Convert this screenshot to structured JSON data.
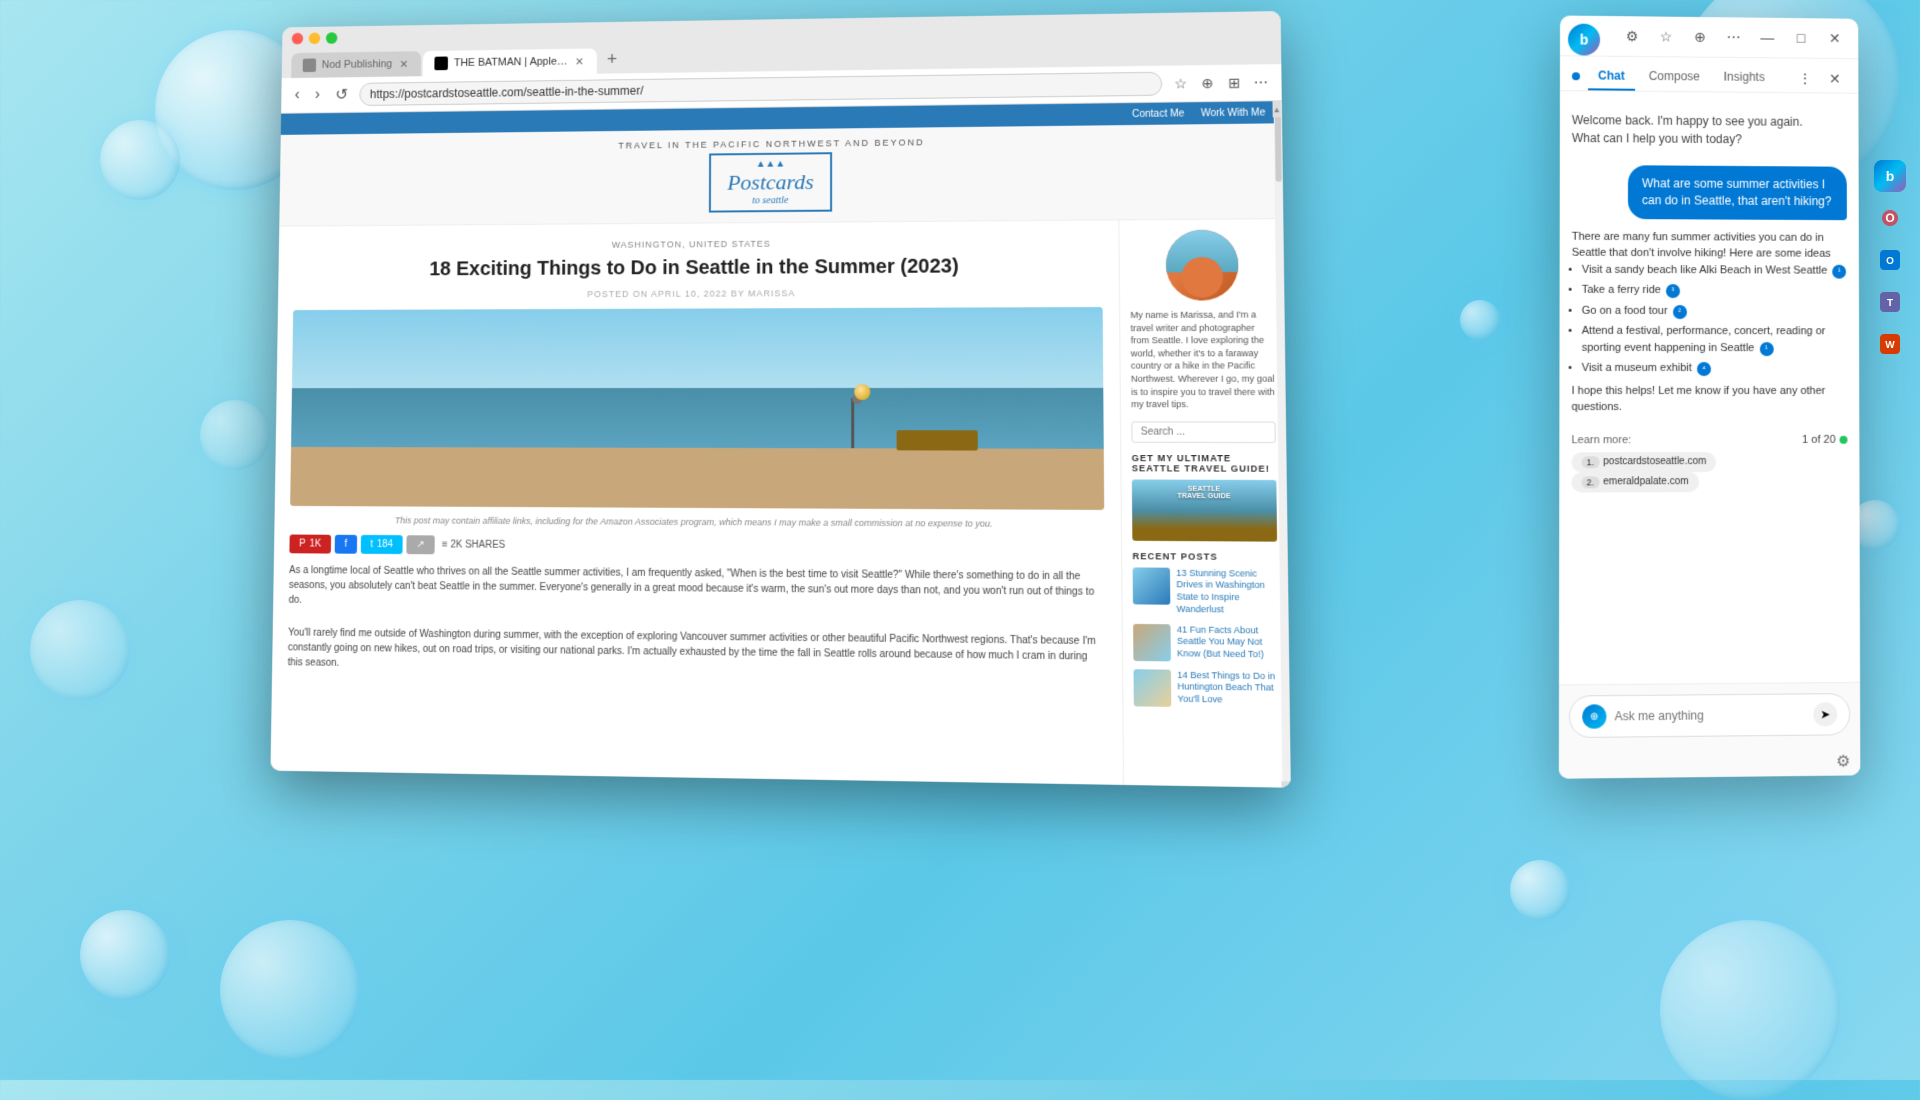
{
  "background": {
    "color": "#7dd4ea"
  },
  "browser": {
    "tabs": [
      {
        "id": "tab1",
        "label": "Nod Publishing",
        "active": false,
        "favicon": "📄"
      },
      {
        "id": "tab2",
        "label": "THE BATMAN | Apple TV",
        "active": true,
        "favicon": "⬛"
      },
      {
        "new_tab_label": "+"
      }
    ],
    "nav": {
      "back_label": "‹",
      "forward_label": "›",
      "refresh_label": "↺"
    },
    "address": "https://postcardstoseattle.com/seattle-in-the-summer/",
    "toolbar_icons": [
      "☆",
      "⊕",
      "⊞",
      "⋯"
    ]
  },
  "website": {
    "top_bar": {
      "links": [
        "Contact Me",
        "Work With Me"
      ]
    },
    "logo_text": "Postcards",
    "logo_subtext": "to seattle",
    "nav_bar_text": "TRAVEL IN THE PACIFIC NORTHWEST AND BEYOND",
    "article": {
      "location": "WASHINGTON, UNITED STATES",
      "title": "18 Exciting Things to Do in Seattle in the Summer (2023)",
      "meta": "POSTED ON APRIL 10, 2022 BY MARISSA",
      "disclaimer": "This post may contain affiliate links, including for the Amazon Associates program, which\nmeans I may make a small commission at no expense to you.",
      "share_buttons": [
        {
          "type": "red",
          "icon": "⊕",
          "count": "1K"
        },
        {
          "type": "blue",
          "icon": "f",
          "label": ""
        },
        {
          "type": "teal",
          "icon": "t",
          "count": "184"
        },
        {
          "type": "gray",
          "icon": "↗",
          "label": ""
        },
        {
          "type": "count",
          "label": "2K SHARES"
        }
      ],
      "text_paragraphs": [
        "As a longtime local of Seattle who thrives on all the Seattle summer activities, I am frequently asked, \"When is the best time to visit Seattle?\" While there's something to do in all the seasons, you absolutely can't beat Seattle in the summer. Everyone's generally in a great mood because it's warm, the sun's out more days than not, and you won't run out of things to do.",
        "You'll rarely find me outside of Washington during summer, with the exception of exploring Vancouver summer activities or other beautiful Pacific Northwest regions. That's because I'm constantly going on new hikes, out on road trips, or visiting our national parks. I'm actually exhausted by the time the fall in Seattle rolls around because of how much I cram in during this season."
      ]
    },
    "sidebar": {
      "bio_text": "My name is Marissa, and I'm a travel writer and photographer from Seattle. I love exploring the world, whether it's to a faraway country or a hike in the Pacific Northwest. Wherever I go, my goal is to inspire you to travel there with my travel tips.",
      "search_placeholder": "Search ...",
      "guide_section_title": "GET MY ULTIMATE SEATTLE TRAVEL GUIDE!",
      "recent_posts_title": "RECENT POSTS",
      "recent_posts": [
        {
          "title": "13 Stunning Scenic Drives in Washington State to Inspire Wanderlust"
        },
        {
          "title": "41 Fun Facts About Seattle You May Not Know (But Need To!)"
        },
        {
          "title": "14 Best Things to Do in Huntington Beach That You'll Love"
        }
      ]
    }
  },
  "copilot": {
    "header_icons": [
      "⚙",
      "☆",
      "⊕",
      "⋯"
    ],
    "close_icon": "✕",
    "tabs": [
      {
        "label": "Chat",
        "active": true
      },
      {
        "label": "Compose",
        "active": false
      },
      {
        "label": "Insights",
        "active": false
      }
    ],
    "tab_icons": [
      "⋮",
      "✕"
    ],
    "welcome_message": "Welcome back. I'm happy to see you again.\nWhat can I help you with today?",
    "user_message": "What are some summer activities I can do in Seattle, that aren't hiking?",
    "ai_response_intro": "There are many fun summer activities you can do in Seattle that don't involve hiking! Here are some ideas",
    "ai_response_items": [
      "Visit a sandy beach like Alki Beach in West Seattle",
      "Take a ferry ride",
      "Go on a food tour",
      "Attend a festival, performance, concert, reading or sporting event happening in Seattle",
      "Visit a museum exhibit"
    ],
    "ai_response_outro": "I hope this helps! Let me know if you have any other questions.",
    "learn_more_label": "Learn more:",
    "sources_count": "1 of 20",
    "sources": [
      {
        "num": "1.",
        "label": "postcardstoseattle.com"
      },
      {
        "num": "2.",
        "label": "emeraldpalate.com"
      }
    ],
    "input_placeholder": "Ask me anything"
  }
}
